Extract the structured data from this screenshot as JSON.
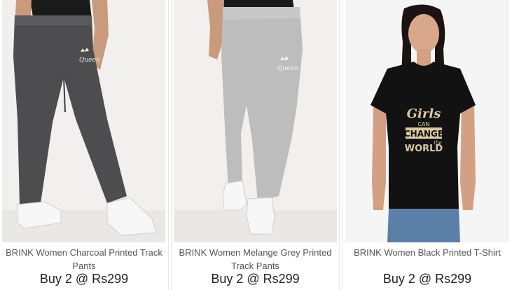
{
  "products": [
    {
      "title": "BRINK Women Charcoal Printed Track Pants",
      "offer": "Buy 2 @ Rs299",
      "image_icon": "charcoal-track-pants-image",
      "color": "#4d4d4f"
    },
    {
      "title": "BRINK Women Melange Grey Printed Track Pants",
      "offer": "Buy 2 @ Rs299",
      "image_icon": "melange-grey-track-pants-image",
      "color": "#b9b9b9"
    },
    {
      "title": "BRINK Women Black Printed T-Shirt",
      "offer": "Buy 2 @ Rs299",
      "image_icon": "black-printed-tshirt-image",
      "color": "#121212",
      "print_text": [
        "Girls",
        "CAN",
        "CHANGE",
        "the",
        "WORLD"
      ]
    }
  ]
}
